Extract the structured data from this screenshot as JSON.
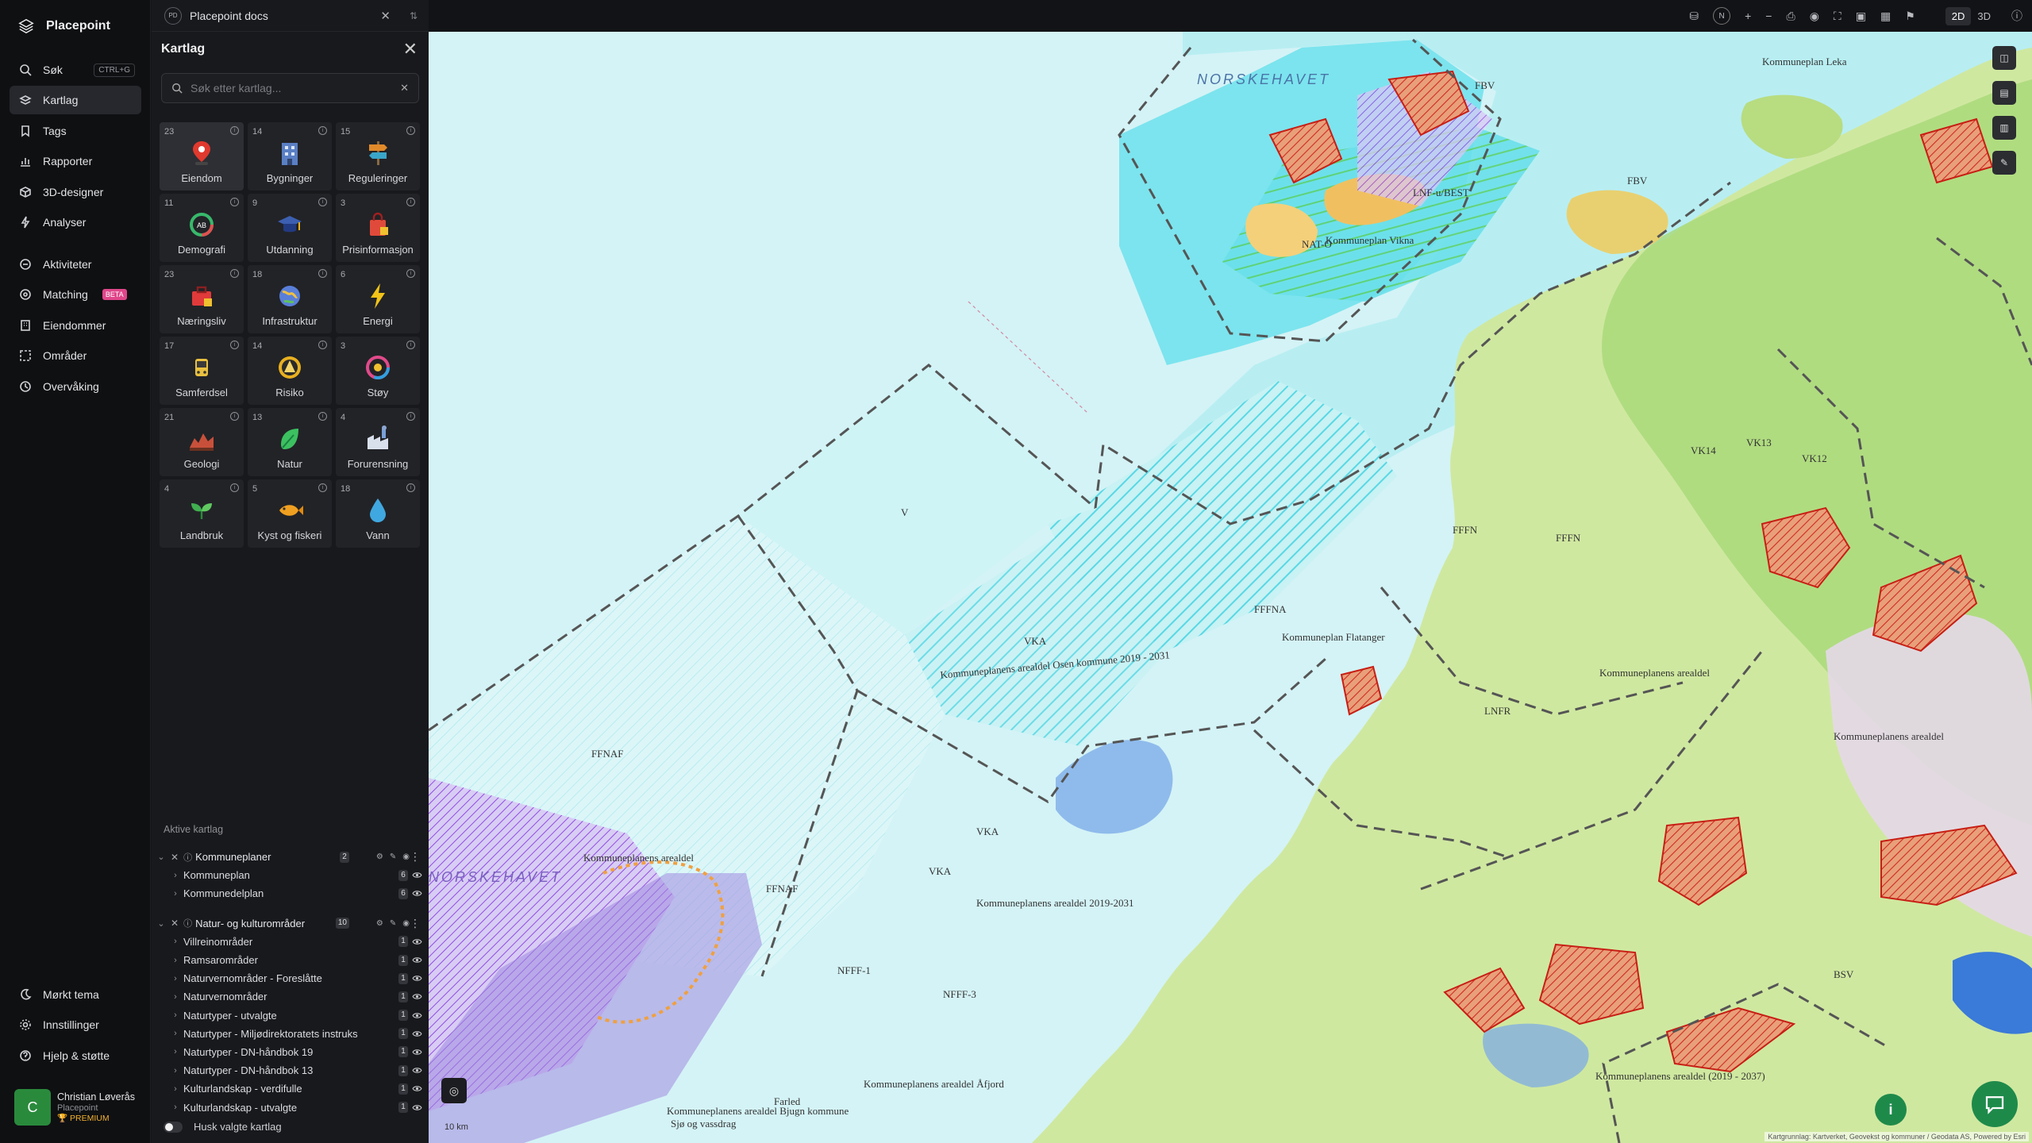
{
  "app": {
    "name": "Placepoint"
  },
  "nav": {
    "items": [
      {
        "label": "Søk",
        "icon": "search-icon",
        "shortcut": "CTRL+G"
      },
      {
        "label": "Kartlag",
        "icon": "layers-icon",
        "active": true
      },
      {
        "label": "Tags",
        "icon": "bookmark-icon"
      },
      {
        "label": "Rapporter",
        "icon": "chart-icon"
      },
      {
        "label": "3D-designer",
        "icon": "cube-icon"
      },
      {
        "label": "Analyser",
        "icon": "bolt-icon"
      }
    ],
    "items2": [
      {
        "label": "Aktiviteter",
        "icon": "activity-icon"
      },
      {
        "label": "Matching",
        "icon": "target-icon",
        "badge": "BETA"
      },
      {
        "label": "Eiendommer",
        "icon": "building-icon"
      },
      {
        "label": "Områder",
        "icon": "area-icon"
      },
      {
        "label": "Overvåking",
        "icon": "monitor-icon"
      }
    ],
    "bottom": [
      {
        "label": "Mørkt tema",
        "icon": "moon-icon"
      },
      {
        "label": "Innstillinger",
        "icon": "gear-icon"
      },
      {
        "label": "Hjelp & støtte",
        "icon": "help-icon"
      }
    ],
    "user": {
      "initial": "C",
      "name": "Christian Løverås",
      "org": "Placepoint",
      "tier": "PREMIUM"
    }
  },
  "doc": {
    "badge": "PD",
    "title": "Placepoint docs"
  },
  "panel": {
    "title": "Kartlag",
    "search_placeholder": "Søk etter kartlag...",
    "tiles": [
      {
        "count": "23",
        "label": "Eiendom",
        "icon": "pin-icon",
        "color": "#e0392e",
        "selected": true
      },
      {
        "count": "14",
        "label": "Bygninger",
        "icon": "building-icon",
        "color": "#5a7fc4"
      },
      {
        "count": "15",
        "label": "Reguleringer",
        "icon": "signpost-icon",
        "color": "#e08a2a"
      },
      {
        "count": "11",
        "label": "Demografi",
        "icon": "demography-icon",
        "color": "#38b86b"
      },
      {
        "count": "9",
        "label": "Utdanning",
        "icon": "graduation-icon",
        "color": "#3c5fb0"
      },
      {
        "count": "3",
        "label": "Prisinformasjon",
        "icon": "shopping-bag-icon",
        "color": "#e04a3a"
      },
      {
        "count": "23",
        "label": "Næringsliv",
        "icon": "briefcase-icon",
        "color": "#e03a3a"
      },
      {
        "count": "18",
        "label": "Infrastruktur",
        "icon": "globe-icon",
        "color": "#5a7fd8"
      },
      {
        "count": "6",
        "label": "Energi",
        "icon": "lightning-icon",
        "color": "#f2c318"
      },
      {
        "count": "17",
        "label": "Samferdsel",
        "icon": "bus-icon",
        "color": "#e8c040"
      },
      {
        "count": "14",
        "label": "Risiko",
        "icon": "warning-icon",
        "color": "#e8b020"
      },
      {
        "count": "3",
        "label": "Støy",
        "icon": "noise-icon",
        "color": "#e04a8a"
      },
      {
        "count": "21",
        "label": "Geologi",
        "icon": "geology-icon",
        "color": "#c8503a"
      },
      {
        "count": "13",
        "label": "Natur",
        "icon": "leaf-icon",
        "color": "#3cc060"
      },
      {
        "count": "4",
        "label": "Forurensning",
        "icon": "factory-icon",
        "color": "#7aa0d8"
      },
      {
        "count": "4",
        "label": "Landbruk",
        "icon": "sprout-icon",
        "color": "#40b050"
      },
      {
        "count": "5",
        "label": "Kyst og fiskeri",
        "icon": "fish-icon",
        "color": "#f0a020"
      },
      {
        "count": "18",
        "label": "Vann",
        "icon": "water-drop-icon",
        "color": "#40a8e0"
      }
    ],
    "active_title": "Aktive kartlag",
    "groups": [
      {
        "label": "Kommuneplaner",
        "count": "2",
        "items": [
          {
            "label": "Kommuneplan",
            "count": "6"
          },
          {
            "label": "Kommunedelplan",
            "count": "6"
          }
        ]
      },
      {
        "label": "Natur- og kulturområder",
        "count": "10",
        "items": [
          {
            "label": "Villreinområder",
            "count": "1"
          },
          {
            "label": "Ramsarområder",
            "count": "1"
          },
          {
            "label": "Naturvernområder - Foreslåtte",
            "count": "1"
          },
          {
            "label": "Naturvernområder",
            "count": "1"
          },
          {
            "label": "Naturtyper - utvalgte",
            "count": "1"
          },
          {
            "label": "Naturtyper - Miljødirektoratets instruks",
            "count": "1"
          },
          {
            "label": "Naturtyper - DN-håndbok 19",
            "count": "1"
          },
          {
            "label": "Naturtyper - DN-håndbok 13",
            "count": "1"
          },
          {
            "label": "Kulturlandskap - verdifulle",
            "count": "1"
          },
          {
            "label": "Kulturlandskap - utvalgte",
            "count": "1"
          }
        ]
      }
    ],
    "remember_label": "Husk valgte kartlag"
  },
  "toolbar": {
    "north": "N",
    "mode_2d": "2D",
    "mode_3d": "3D"
  },
  "map": {
    "sea_label": "NORSKEHAVET",
    "labels": [
      "FBV",
      "Kommuneplan Leka",
      "NAT-O",
      "Kommuneplan Vikna",
      "LNF-u/BEST",
      "FBV",
      "FFFN",
      "VK14",
      "VK13",
      "VK12",
      "FFFN",
      "FFFNA",
      "Kommuneplan Flatanger",
      "VKA",
      "Kommuneplanens arealdel Osen kommune 2019 - 2031",
      "FFNAF",
      "V",
      "VKA",
      "VKA",
      "Kommuneplanens arealdel 2019-2031",
      "NFFF-1",
      "NFFF-3",
      "Kommuneplanens arealdel",
      "Kommuneplanens arealdel",
      "Kommuneplanens arealdel (2019 - 2037)",
      "LNFR",
      "BSV",
      "Kommuneplanens arealdel Bjugn kommune",
      "Sjø og vassdrag",
      "Farled",
      "FFNAF",
      "Kommuneplanens arealdel Åfjord",
      "Kommuneplanens arealdel",
      "NORSKEHAVET"
    ],
    "scale": "10 km",
    "attribution": "Kartgrunnlag: Kartverket, Geovekst og kommuner / Geodata AS, Powered by Esri"
  }
}
